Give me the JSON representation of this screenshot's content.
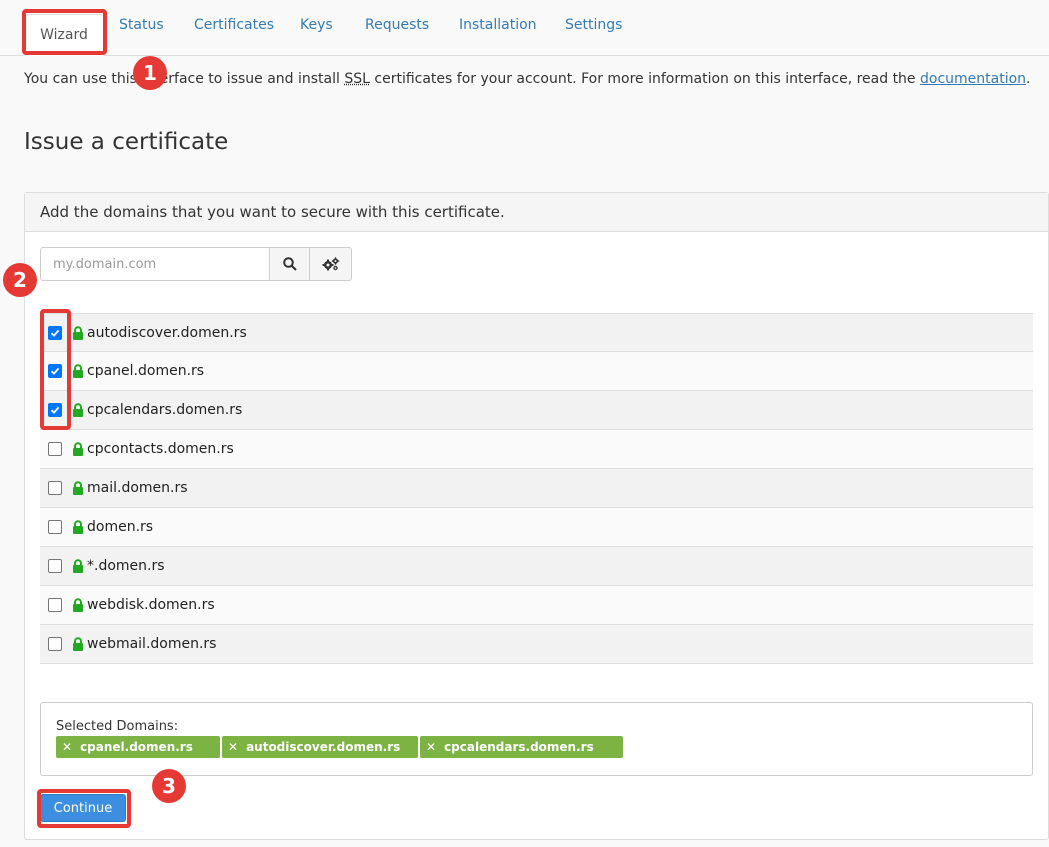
{
  "tabs": [
    {
      "label": "Wizard"
    },
    {
      "label": "Status"
    },
    {
      "label": "Certificates"
    },
    {
      "label": "Keys"
    },
    {
      "label": "Requests"
    },
    {
      "label": "Installation"
    },
    {
      "label": "Settings"
    }
  ],
  "intro": {
    "text_before": "You can use this interface to issue and install ",
    "ssl": "SSL",
    "text_middle": " certificates for your account. For more information on this interface, read the ",
    "link": "documentation",
    "text_after": "."
  },
  "section_title": "Issue a certificate",
  "panel": {
    "heading": "Add the domains that you want to secure with this certificate.",
    "search_placeholder": "my.domain.com"
  },
  "domains": [
    {
      "name": "autodiscover.domen.rs",
      "checked": true
    },
    {
      "name": "cpanel.domen.rs",
      "checked": true
    },
    {
      "name": "cpcalendars.domen.rs",
      "checked": true
    },
    {
      "name": "cpcontacts.domen.rs",
      "checked": false
    },
    {
      "name": "mail.domen.rs",
      "checked": false
    },
    {
      "name": "domen.rs",
      "checked": false
    },
    {
      "name": "*.domen.rs",
      "checked": false
    },
    {
      "name": "webdisk.domen.rs",
      "checked": false
    },
    {
      "name": "webmail.domen.rs",
      "checked": false
    }
  ],
  "selected": {
    "label": "Selected Domains:",
    "tags": [
      "cpanel.domen.rs",
      "autodiscover.domen.rs",
      "cpcalendars.domen.rs"
    ]
  },
  "continue_label": "Continue",
  "annotations": {
    "badge1": "1",
    "badge2": "2",
    "badge3": "3"
  },
  "colors": {
    "highlight": "#e53935",
    "link": "#337ab7",
    "tag": "#7cb342",
    "lock": "#22a822",
    "button": "#3b8ee0"
  },
  "icons": {
    "search": "search-icon",
    "gear": "gears-icon",
    "lock": "lock-icon",
    "remove": "remove-x-icon"
  }
}
